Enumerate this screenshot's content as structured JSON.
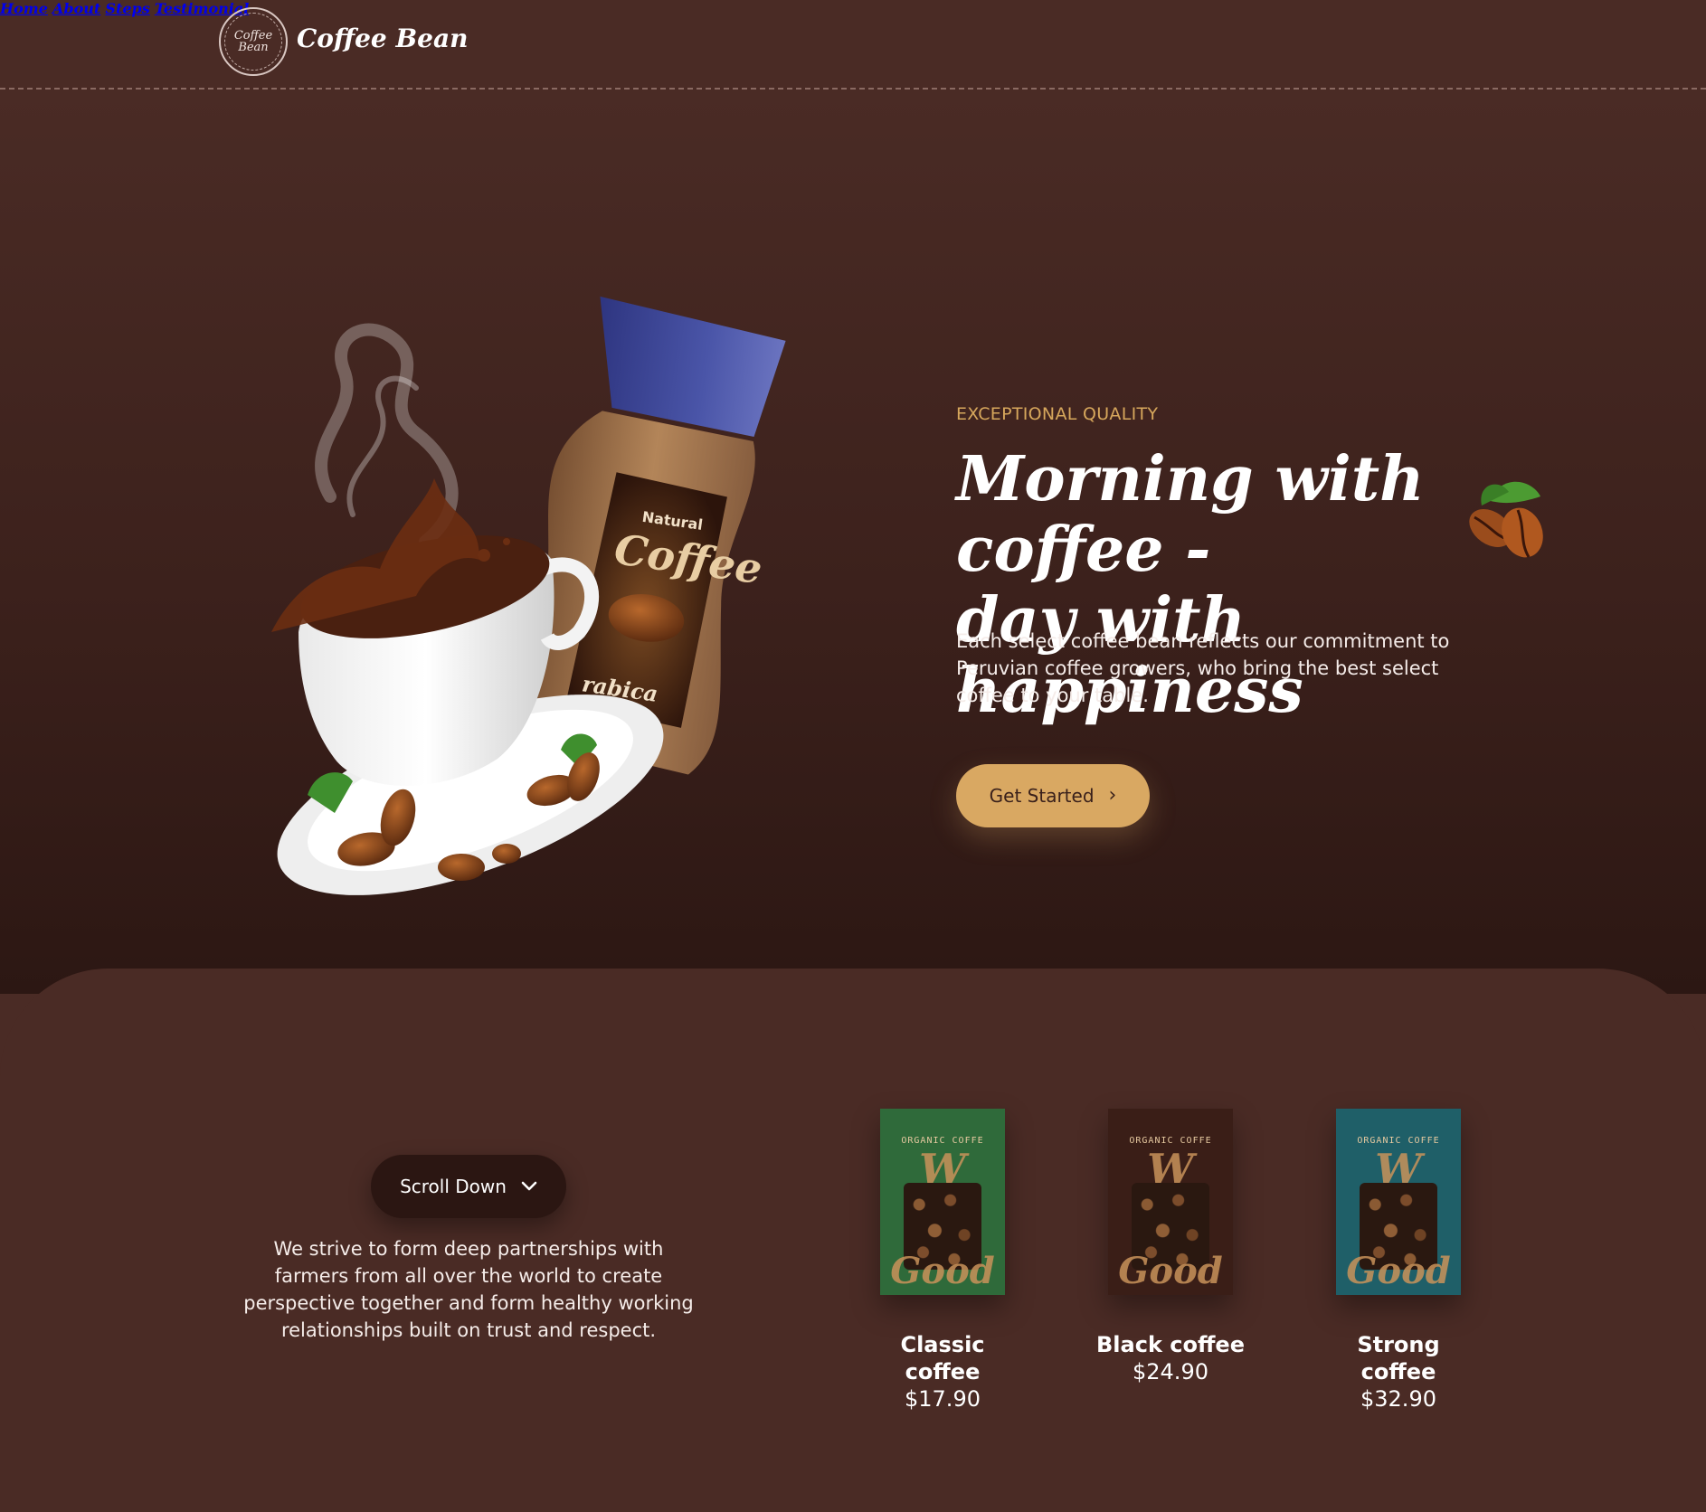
{
  "header": {
    "logo_badge": "Coffee Bean",
    "logo_text": "Coffee Bean",
    "nav": [
      "Home",
      "About",
      "Steps",
      "Testimonial"
    ]
  },
  "hero": {
    "jar_label_top": "Natural",
    "jar_label_main": "Coffee",
    "jar_label_bottom": "rabica",
    "eyebrow": "EXCEPTIONAL QUALITY",
    "headline_line1": "Morning with coffee -",
    "headline_line2": "day with happiness",
    "description": "Each select coffee bean reflects our commitment to Peruvian coffee growers, who bring the best select coffee to your table.",
    "cta_label": "Get Started"
  },
  "lower": {
    "scroll_label": "Scroll Down",
    "description": "We strive to form deep partnerships with farmers from all over the world to create perspective together and form healthy working relationships built on trust and respect.",
    "products": [
      {
        "name": "Classic coffee",
        "price": "$17.90",
        "bag_color": "#2f6a3a",
        "bag_label": "ORGANIC COFFE"
      },
      {
        "name": "Black coffee",
        "price": "$24.90",
        "bag_color": "#3a1e17",
        "bag_label": "ORGANIC COFFE"
      },
      {
        "name": "Strong coffee",
        "price": "$32.90",
        "bag_color": "#1f5f68",
        "bag_label": "ORGANIC COFFE"
      }
    ]
  },
  "colors": {
    "background": "#4a2b25",
    "accent": "#d9a862",
    "eyebrow": "#d7a75c",
    "dark_button": "#2b1612"
  }
}
